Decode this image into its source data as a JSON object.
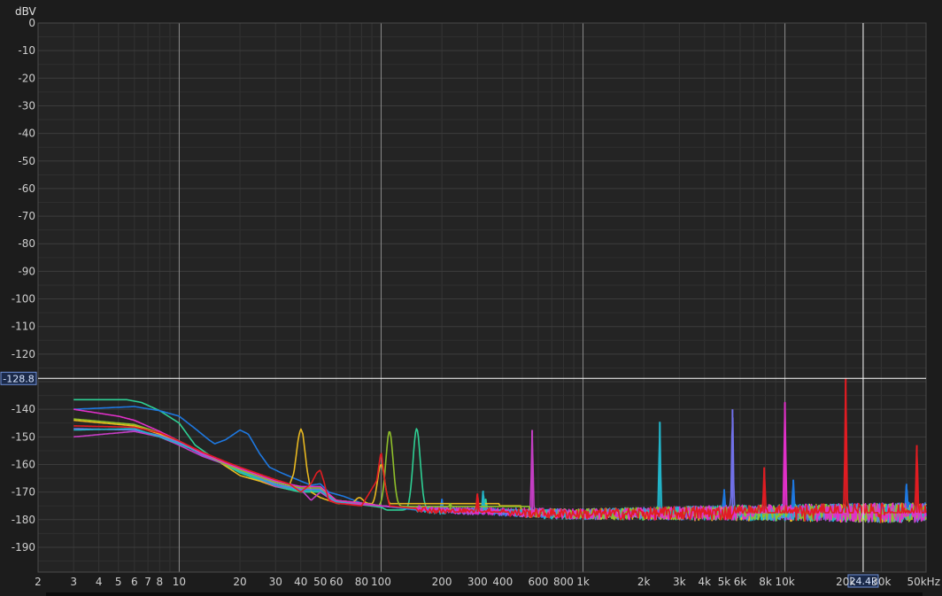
{
  "chart_data": {
    "type": "line",
    "title": "",
    "ylabel": "dBV",
    "xlabel": "",
    "x_scale": "log",
    "xlim": [
      2,
      50000
    ],
    "ylim": [
      -199,
      0
    ],
    "y_ticks": [
      0,
      -10,
      -20,
      -30,
      -40,
      -50,
      -60,
      -70,
      -80,
      -90,
      -100,
      -110,
      -120,
      -140,
      -150,
      -160,
      -170,
      -180,
      -190
    ],
    "x_ticks": [
      {
        "v": 2,
        "label": "2"
      },
      {
        "v": 3,
        "label": "3"
      },
      {
        "v": 4,
        "label": "4"
      },
      {
        "v": 5,
        "label": "5"
      },
      {
        "v": 6,
        "label": "6"
      },
      {
        "v": 7,
        "label": "7"
      },
      {
        "v": 8,
        "label": "8"
      },
      {
        "v": 10,
        "label": "10"
      },
      {
        "v": 20,
        "label": "20"
      },
      {
        "v": 30,
        "label": "30"
      },
      {
        "v": 40,
        "label": "40"
      },
      {
        "v": 50,
        "label": "50"
      },
      {
        "v": 60,
        "label": "60"
      },
      {
        "v": 80,
        "label": "80"
      },
      {
        "v": 100,
        "label": "100"
      },
      {
        "v": 200,
        "label": "200"
      },
      {
        "v": 300,
        "label": "300"
      },
      {
        "v": 400,
        "label": "400"
      },
      {
        "v": 600,
        "label": "600"
      },
      {
        "v": 800,
        "label": "800"
      },
      {
        "v": 1000,
        "label": "1k"
      },
      {
        "v": 2000,
        "label": "2k"
      },
      {
        "v": 3000,
        "label": "3k"
      },
      {
        "v": 4000,
        "label": "4k"
      },
      {
        "v": 5000,
        "label": "5k"
      },
      {
        "v": 6000,
        "label": "6k"
      },
      {
        "v": 8000,
        "label": "8k"
      },
      {
        "v": 10000,
        "label": "10k"
      },
      {
        "v": 20000,
        "label": "20k"
      },
      {
        "v": 30000,
        "label": "30k"
      },
      {
        "v": 50000,
        "label": "50kHz"
      }
    ],
    "cursor": {
      "y": -128.8,
      "y_label": "-128.8",
      "x": 24400,
      "x_label": "24.4k"
    },
    "grid": true,
    "legend": "none",
    "series": [
      {
        "color": "#2ecf94",
        "points": [
          [
            3,
            -136.5
          ],
          [
            5.5,
            -136.5
          ],
          [
            6.5,
            -137.5
          ],
          [
            8,
            -140.5
          ],
          [
            10,
            -145
          ],
          [
            12,
            -153
          ],
          [
            15,
            -158
          ],
          [
            20,
            -163
          ],
          [
            30,
            -168
          ],
          [
            40,
            -170
          ],
          [
            50,
            -170
          ],
          [
            60,
            -173.5
          ],
          [
            70,
            -174
          ],
          [
            100,
            -175.5
          ],
          [
            110,
            -177
          ],
          [
            150,
            -176.5
          ],
          [
            200,
            -177
          ],
          [
            300,
            -177.5
          ],
          [
            500,
            -177.8
          ],
          [
            1000,
            -178
          ],
          [
            2000,
            -178
          ],
          [
            5000,
            -177.5
          ],
          [
            10000,
            -177.5
          ],
          [
            20000,
            -177.5
          ],
          [
            50000,
            -177.5
          ]
        ],
        "peaks": [
          [
            150,
            -147
          ],
          [
            330,
            -172.5
          ]
        ]
      },
      {
        "color": "#1e78e0",
        "points": [
          [
            3,
            -140
          ],
          [
            6,
            -139
          ],
          [
            8,
            -140.5
          ],
          [
            10,
            -142.5
          ],
          [
            12,
            -147
          ],
          [
            14,
            -151
          ],
          [
            15,
            -152.5
          ],
          [
            17,
            -151
          ],
          [
            20,
            -147.5
          ],
          [
            22,
            -149
          ],
          [
            25,
            -156
          ],
          [
            28,
            -161
          ],
          [
            32,
            -163
          ],
          [
            40,
            -166
          ],
          [
            45,
            -167.5
          ],
          [
            50,
            -167
          ],
          [
            55,
            -170
          ],
          [
            65,
            -171.5
          ],
          [
            80,
            -174
          ],
          [
            100,
            -175
          ],
          [
            150,
            -176.5
          ],
          [
            200,
            -177
          ],
          [
            500,
            -177.5
          ],
          [
            1000,
            -178
          ],
          [
            3000,
            -177.8
          ],
          [
            10000,
            -177.5
          ],
          [
            30000,
            -177
          ],
          [
            50000,
            -177
          ]
        ],
        "peaks": [
          [
            200,
            -172.5
          ],
          [
            1500,
            -176
          ],
          [
            5000,
            -169
          ],
          [
            11000,
            -165.5
          ],
          [
            40000,
            -167
          ]
        ]
      },
      {
        "color": "#e8b820",
        "points": [
          [
            3,
            -144
          ],
          [
            6,
            -146
          ],
          [
            8,
            -149
          ],
          [
            10,
            -152
          ],
          [
            12,
            -155
          ],
          [
            15,
            -158
          ],
          [
            20,
            -164
          ],
          [
            25,
            -166
          ],
          [
            30,
            -168
          ],
          [
            35,
            -168
          ],
          [
            37,
            -163
          ],
          [
            39,
            -150
          ],
          [
            40,
            -147
          ],
          [
            41,
            -149
          ],
          [
            43,
            -162
          ],
          [
            45,
            -170
          ],
          [
            50,
            -172
          ],
          [
            60,
            -174
          ],
          [
            70,
            -175
          ],
          [
            80,
            -174
          ],
          [
            100,
            -175
          ],
          [
            200,
            -176.5
          ],
          [
            500,
            -177.5
          ],
          [
            2000,
            -178
          ],
          [
            10000,
            -177.5
          ],
          [
            50000,
            -177.5
          ]
        ],
        "peaks": [
          [
            78,
            -172
          ],
          [
            100,
            -160
          ]
        ]
      },
      {
        "color": "#c43ec4",
        "points": [
          [
            3,
            -150
          ],
          [
            6,
            -148
          ],
          [
            8,
            -150
          ],
          [
            10,
            -153
          ],
          [
            13,
            -157
          ],
          [
            17,
            -160
          ],
          [
            20,
            -162
          ],
          [
            30,
            -168
          ],
          [
            40,
            -169
          ],
          [
            45,
            -173
          ],
          [
            50,
            -170
          ],
          [
            60,
            -174
          ],
          [
            80,
            -174.5
          ],
          [
            100,
            -175
          ],
          [
            200,
            -176.5
          ],
          [
            500,
            -177.5
          ],
          [
            1000,
            -178
          ],
          [
            5000,
            -177.5
          ],
          [
            50000,
            -177.5
          ]
        ],
        "peaks": [
          [
            560,
            -147.5
          ],
          [
            2000,
            -176.5
          ]
        ]
      },
      {
        "color": "#7070e8",
        "points": [
          [
            3,
            -147
          ],
          [
            6,
            -147.5
          ],
          [
            8,
            -149.5
          ],
          [
            10,
            -152
          ],
          [
            13,
            -156.5
          ],
          [
            17,
            -160
          ],
          [
            20,
            -162
          ],
          [
            30,
            -167
          ],
          [
            40,
            -169
          ],
          [
            50,
            -169
          ],
          [
            60,
            -173
          ],
          [
            80,
            -174
          ],
          [
            100,
            -175
          ],
          [
            200,
            -176.5
          ],
          [
            1000,
            -178
          ],
          [
            5000,
            -177.5
          ],
          [
            50000,
            -177.5
          ]
        ],
        "peaks": [
          [
            5500,
            -140
          ]
        ]
      },
      {
        "color": "#22b4c8",
        "points": [
          [
            3,
            -147.5
          ],
          [
            6,
            -147
          ],
          [
            8,
            -150
          ],
          [
            10,
            -152.5
          ],
          [
            13,
            -156
          ],
          [
            17,
            -160
          ],
          [
            20,
            -162.5
          ],
          [
            30,
            -167.5
          ],
          [
            40,
            -169.5
          ],
          [
            50,
            -169.5
          ],
          [
            60,
            -173.5
          ],
          [
            80,
            -174
          ],
          [
            100,
            -175
          ],
          [
            200,
            -177
          ],
          [
            600,
            -178
          ],
          [
            1000,
            -178
          ],
          [
            5000,
            -177.5
          ],
          [
            50000,
            -177.5
          ]
        ],
        "peaks": [
          [
            320,
            -169.5
          ],
          [
            2400,
            -144.5
          ]
        ]
      },
      {
        "color": "#8fbf2a",
        "points": [
          [
            3,
            -143.5
          ],
          [
            6,
            -145.5
          ],
          [
            8,
            -148.5
          ],
          [
            10,
            -151.5
          ],
          [
            13,
            -156
          ],
          [
            17,
            -160
          ],
          [
            20,
            -162
          ],
          [
            30,
            -166.5
          ],
          [
            40,
            -168.5
          ],
          [
            50,
            -168.5
          ],
          [
            60,
            -173
          ],
          [
            80,
            -174
          ],
          [
            100,
            -175
          ],
          [
            200,
            -176.5
          ],
          [
            1000,
            -178
          ],
          [
            5000,
            -177.5
          ],
          [
            50000,
            -177.5
          ]
        ],
        "peaks": [
          [
            110,
            -148
          ],
          [
            220,
            -174
          ]
        ]
      },
      {
        "color": "#e030c8",
        "points": [
          [
            3,
            -140
          ],
          [
            5,
            -142.5
          ],
          [
            6,
            -144
          ],
          [
            8,
            -148
          ],
          [
            10,
            -151.5
          ],
          [
            13,
            -156
          ],
          [
            17,
            -159.5
          ],
          [
            20,
            -161.5
          ],
          [
            30,
            -166
          ],
          [
            40,
            -168
          ],
          [
            50,
            -168
          ],
          [
            60,
            -173
          ],
          [
            80,
            -174
          ],
          [
            100,
            -175
          ],
          [
            200,
            -176.5
          ],
          [
            1000,
            -178
          ],
          [
            5000,
            -177.5
          ],
          [
            50000,
            -177.5
          ]
        ],
        "peaks": [
          [
            10000,
            -137.5
          ]
        ]
      },
      {
        "color": "#e01c22",
        "points": [
          [
            3,
            -146
          ],
          [
            6,
            -146.5
          ],
          [
            8,
            -148.5
          ],
          [
            10,
            -151.5
          ],
          [
            13,
            -155.5
          ],
          [
            17,
            -159
          ],
          [
            20,
            -161
          ],
          [
            30,
            -165.5
          ],
          [
            35,
            -167
          ],
          [
            40,
            -170
          ],
          [
            45,
            -167
          ],
          [
            48,
            -163
          ],
          [
            50,
            -162
          ],
          [
            52,
            -166
          ],
          [
            55,
            -173
          ],
          [
            60,
            -174
          ],
          [
            80,
            -175
          ],
          [
            95,
            -166
          ],
          [
            100,
            -155
          ],
          [
            105,
            -168
          ],
          [
            110,
            -175
          ],
          [
            200,
            -177
          ],
          [
            1000,
            -178
          ],
          [
            5000,
            -177.5
          ],
          [
            50000,
            -177.5
          ]
        ],
        "peaks": [
          [
            300,
            -170.5
          ],
          [
            7900,
            -161
          ],
          [
            20000,
            -128.8
          ],
          [
            45000,
            -153
          ]
        ]
      }
    ]
  }
}
